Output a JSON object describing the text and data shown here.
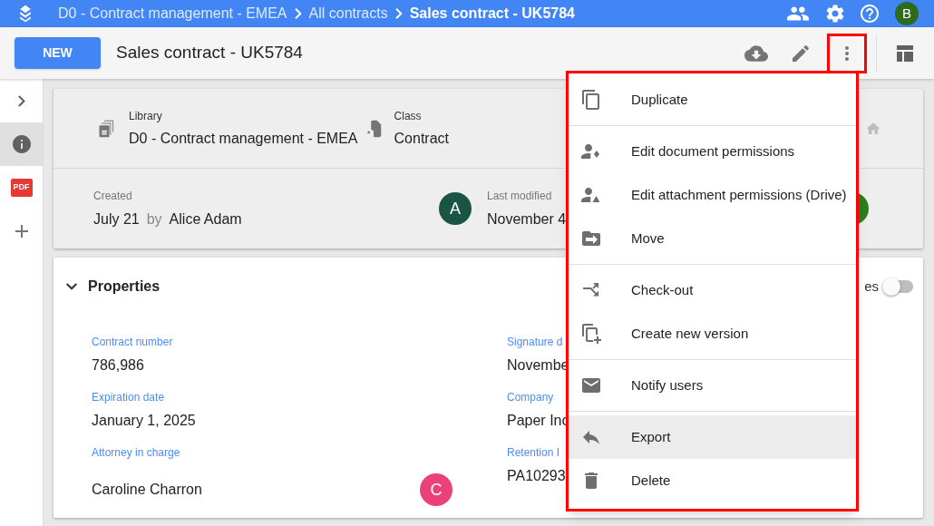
{
  "app_bar": {
    "breadcrumbs": [
      {
        "label": "D0 - Contract management - EMEA",
        "current": false
      },
      {
        "label": "All contracts",
        "current": false
      },
      {
        "label": "Sales contract - UK5784",
        "current": true
      }
    ],
    "user_initial": "B"
  },
  "toolbar": {
    "new_button": "NEW",
    "title": "Sales contract - UK5784",
    "more_selected": true
  },
  "sidebar": {
    "items": [
      {
        "kind": "expand",
        "selected": false
      },
      {
        "kind": "info",
        "selected": true
      },
      {
        "kind": "pdf",
        "label": "PDF",
        "selected": false
      },
      {
        "kind": "add",
        "selected": false
      }
    ]
  },
  "summary": {
    "library_label": "Library",
    "library": "D0 - Contract management - EMEA",
    "class_label": "Class",
    "class": "Contract",
    "created_label": "Created",
    "created": "July 21",
    "by": "by",
    "created_by": "Alice Adam",
    "creator_initial": "A",
    "modified_label": "Last modified",
    "modified": "November 4"
  },
  "properties": {
    "title": "Properties",
    "expanded": true,
    "toggle_label": "es",
    "toggle_on": false,
    "fields": [
      {
        "label": "Contract number",
        "value": "786,986"
      },
      {
        "label": "Signature d",
        "value": "Novembe"
      },
      {
        "label": "Expiration date",
        "value": "January 1, 2025"
      },
      {
        "label": "Company",
        "value": "Paper Inc"
      },
      {
        "label": "Attorney in charge",
        "value": "Caroline Charron",
        "avatar": "C"
      },
      {
        "label": "Retention I",
        "value": "PA10293"
      }
    ]
  },
  "menu": {
    "groups": [
      [
        {
          "kind": "duplicate",
          "label": "Duplicate",
          "highlighted": false
        }
      ],
      [
        {
          "kind": "doc-permissions",
          "label": "Edit document permissions",
          "highlighted": false
        },
        {
          "kind": "attachment-permissions",
          "label": "Edit attachment permissions (Drive)",
          "highlighted": false
        },
        {
          "kind": "move",
          "label": "Move",
          "highlighted": false
        }
      ],
      [
        {
          "kind": "checkout",
          "label": "Check-out",
          "highlighted": false
        },
        {
          "kind": "new-version",
          "label": "Create new version",
          "highlighted": false
        }
      ],
      [
        {
          "kind": "notify",
          "label": "Notify users",
          "highlighted": false
        }
      ],
      [
        {
          "kind": "export",
          "label": "Export",
          "highlighted": true
        },
        {
          "kind": "delete",
          "label": "Delete",
          "highlighted": false
        }
      ]
    ]
  }
}
